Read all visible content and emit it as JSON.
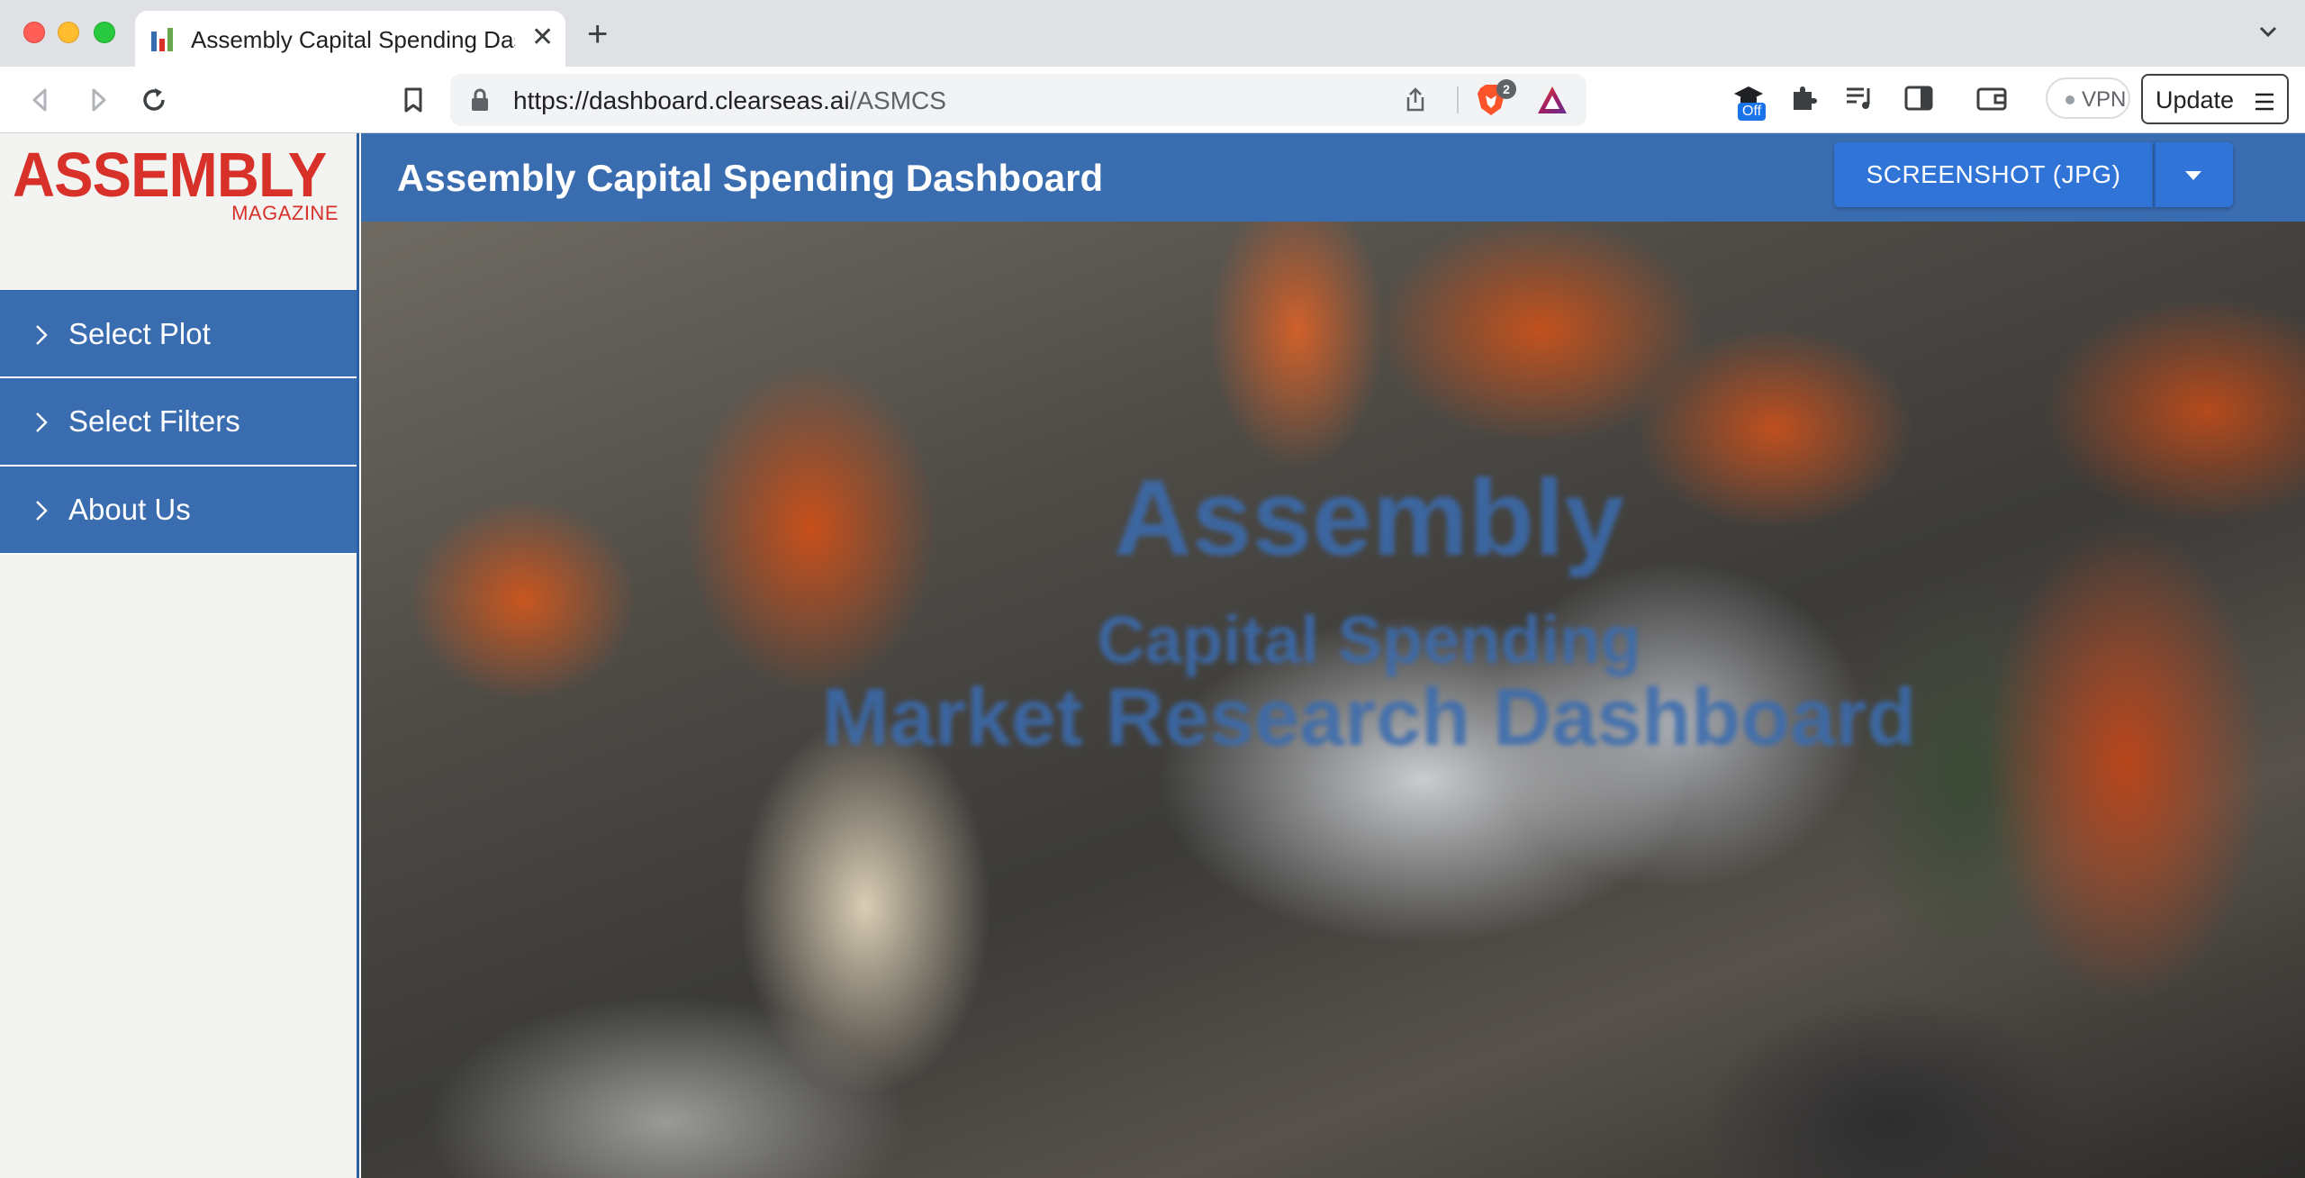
{
  "browser": {
    "tab_title": "Assembly Capital Spending Das",
    "url_scheme_host": "https://dashboard.clearseas.ai",
    "url_path": "/ASMCS",
    "shield_count": "2",
    "extension_badge": "Off",
    "vpn_label": "VPN",
    "update_label": "Update"
  },
  "logo": {
    "main": "ASSEMBLY",
    "sub": "MAGAZINE"
  },
  "sidebar": {
    "items": [
      {
        "label": "Select Plot"
      },
      {
        "label": "Select Filters"
      },
      {
        "label": "About Us"
      }
    ]
  },
  "header": {
    "title": "Assembly Capital Spending Dashboard",
    "screenshot_button": "SCREENSHOT (JPG)"
  },
  "hero": {
    "line1": "Assembly",
    "line2": "Capital Spending",
    "line3": "Market Research Dashboard"
  },
  "colors": {
    "brand_blue": "#3a6cb0",
    "brand_red": "#d7312a",
    "button_blue": "#2f74d6"
  }
}
